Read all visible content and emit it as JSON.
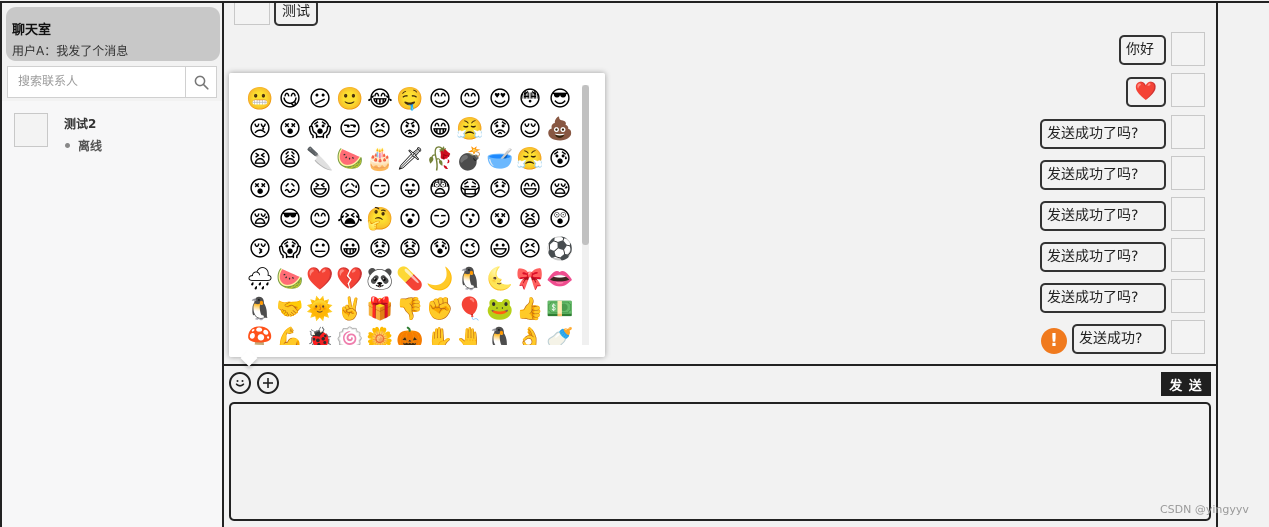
{
  "sidebar": {
    "room": {
      "title": "聊天室",
      "last_message": "用户A：我发了个消息"
    },
    "search": {
      "placeholder": "搜索联系人"
    },
    "contacts": [
      {
        "name": "测试2",
        "status": "离线"
      }
    ]
  },
  "chat": {
    "top_partial": "测试",
    "messages": [
      {
        "type": "text",
        "text": "你好"
      },
      {
        "type": "emoji",
        "emoji": "❤️"
      },
      {
        "type": "text",
        "text": "发送成功了吗?"
      },
      {
        "type": "text",
        "text": "发送成功了吗?"
      },
      {
        "type": "text",
        "text": "发送成功了吗?"
      },
      {
        "type": "text",
        "text": "发送成功了吗?"
      },
      {
        "type": "text",
        "text": "发送成功了吗?"
      },
      {
        "type": "text",
        "text": "发送成功?",
        "failed": true
      }
    ],
    "error_icon": "!",
    "error_color": "#f07a1e"
  },
  "emoji_panel": {
    "emojis": [
      "😬",
      "😋",
      "😕",
      "🙂",
      "😂",
      "🤤",
      "😊",
      "😊",
      "😍",
      "😳",
      "😎",
      "😢",
      "😵",
      "😱",
      "😒",
      "😣",
      "😡",
      "😁",
      "😤",
      "😟",
      "😌",
      "💩",
      "😫",
      "😩",
      "🔪",
      "🍉",
      "🎂",
      "🗡",
      "🥀",
      "💣",
      "🥣",
      "😤",
      "😰",
      "😵",
      "😖",
      "😆",
      "😥",
      "😏",
      "😛",
      "😨",
      "😷",
      "😞",
      "😄",
      "😪",
      "😪",
      "😎",
      "😊",
      "😭",
      "🤔",
      "😮",
      "😏",
      "😗",
      "😵",
      "😫",
      "😲",
      "😚",
      "😱",
      "😐",
      "😀",
      "😟",
      "😧",
      "😰",
      "😉",
      "😃",
      "😣",
      "⚽",
      "🌧",
      "🍉",
      "❤️",
      "💔",
      "🐼",
      "💊",
      "🌙",
      "🐧",
      "🌜",
      "🎀",
      "👄",
      "🐧",
      "🤝",
      "🌞",
      "✌️",
      "🎁",
      "👎",
      "✊",
      "🎈",
      "🐸",
      "👍",
      "💵",
      "🍄",
      "💪",
      "🐞",
      "🍥",
      "🌼",
      "🎃",
      "✋",
      "🤚",
      "🐧",
      "👌",
      "🍼"
    ],
    "scroll_position": 0.0
  },
  "composer": {
    "emoji_icon": "emoji-face-icon",
    "add_icon": "plus-icon",
    "send_label": "发 送"
  },
  "watermark": "CSDN @yingyyv"
}
